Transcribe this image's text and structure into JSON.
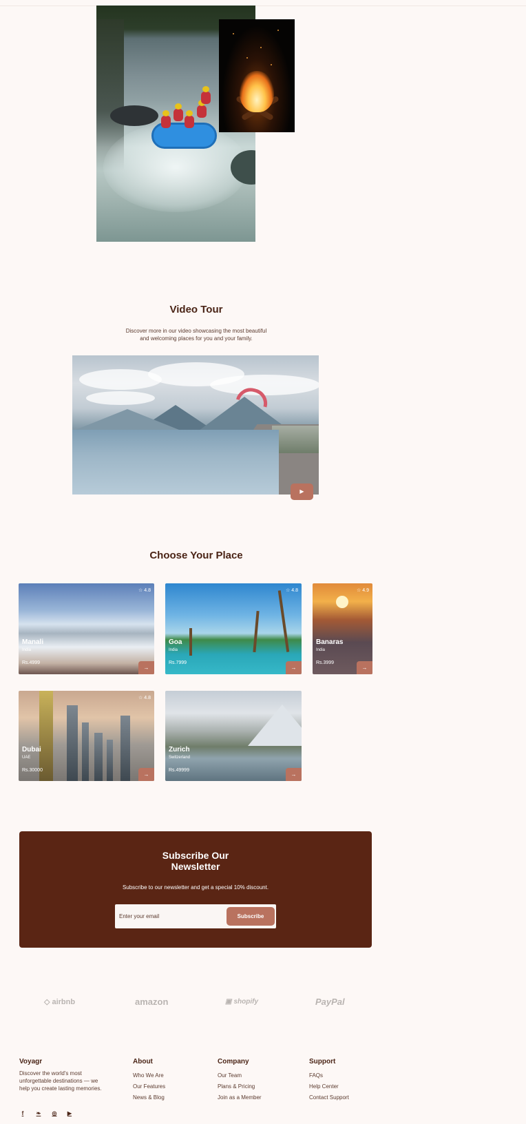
{
  "video_tour": {
    "title": "Video Tour",
    "desc_line1": "Discover more in our video showcasing the most beautiful",
    "desc_line2": "and welcoming places for you and your family.",
    "play_icon": "▶"
  },
  "choose": {
    "title": "Choose Your Place",
    "cards": [
      {
        "name": "Manali",
        "country": "India",
        "price": "Rs.4999",
        "rating": "☆ 4.8"
      },
      {
        "name": "Goa",
        "country": "India",
        "price": "Rs.7999",
        "rating": "☆ 4.8"
      },
      {
        "name": "Banaras",
        "country": "India",
        "price": "Rs.3999",
        "rating": "☆ 4.9"
      },
      {
        "name": "Dubai",
        "country": "UAE",
        "price": "Rs.30000",
        "rating": "☆ 4.8"
      },
      {
        "name": "Zurich",
        "country": "Switzerland",
        "price": "Rs.49999",
        "rating": ""
      }
    ],
    "go_icon": "→"
  },
  "newsletter": {
    "title_line1": "Subscribe Our",
    "title_line2": "Newsletter",
    "desc": "Subscribe to our newsletter and get a special 10% discount.",
    "placeholder": "Enter your email",
    "button": "Subscribe"
  },
  "partners": [
    "airbnb",
    "amazon",
    "shopify",
    "PayPal"
  ],
  "footer": {
    "brand": "Voyagr",
    "about": "Discover the world's most unforgettable destinations — we help you create lasting memories.",
    "columns": [
      {
        "title": "About",
        "links": [
          "Who We Are",
          "Our Features",
          "News & Blog"
        ]
      },
      {
        "title": "Company",
        "links": [
          "Our Team",
          "Plans & Pricing",
          "Join as a Member"
        ]
      },
      {
        "title": "Support",
        "links": [
          "FAQs",
          "Help Center",
          "Contact Support"
        ]
      }
    ],
    "social": [
      {
        "icon": "facebook-icon",
        "glyph": "f"
      },
      {
        "icon": "twitter-icon",
        "glyph": "❧"
      },
      {
        "icon": "instagram-icon",
        "glyph": "◎"
      },
      {
        "icon": "youtube-icon",
        "glyph": "▶"
      }
    ]
  },
  "colors": {
    "background": "#fdf8f6",
    "text_dark": "#4a2416",
    "accent": "#b9725f",
    "newsletter_bg": "#5a2514",
    "partner_gray": "#b9b4b1"
  }
}
